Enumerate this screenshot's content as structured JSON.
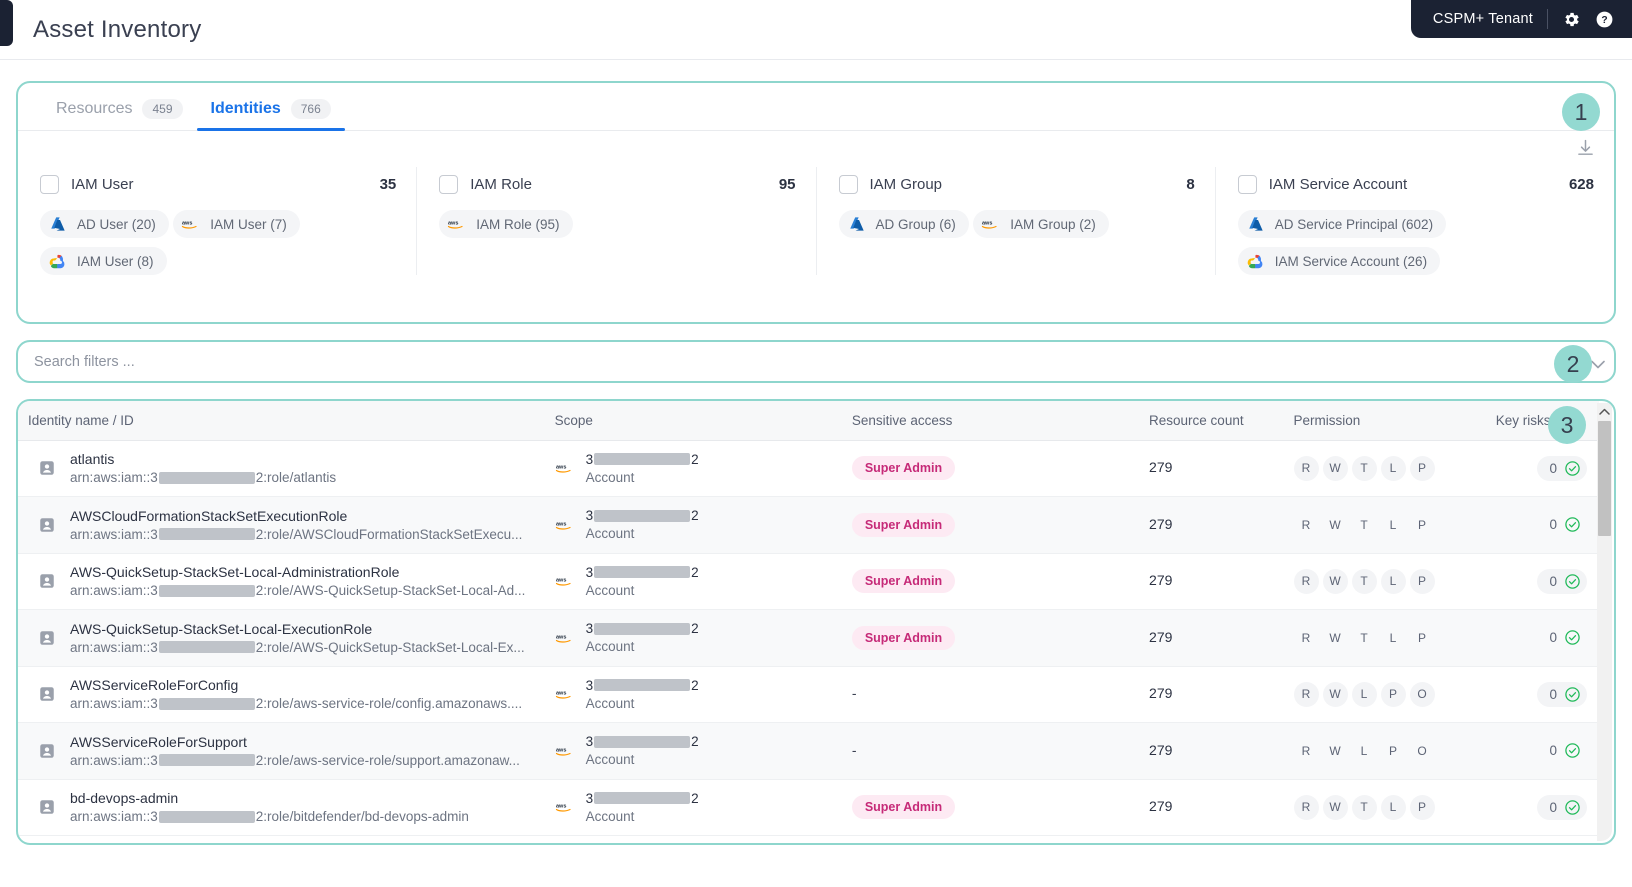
{
  "header": {
    "title": "Asset Inventory",
    "tenant": "CSPM+ Tenant",
    "settings_icon": "gear-icon",
    "help_icon": "help-icon"
  },
  "steps": {
    "one": "1",
    "two": "2",
    "three": "3"
  },
  "tabs": [
    {
      "label": "Resources",
      "count": "459",
      "active": false
    },
    {
      "label": "Identities",
      "count": "766",
      "active": true
    }
  ],
  "toolbar": {
    "download_icon": "download-icon"
  },
  "type_cards": [
    {
      "title": "IAM User",
      "count": "35",
      "pills": [
        {
          "provider": "azure",
          "label": "AD User (20)"
        },
        {
          "provider": "aws",
          "label": "IAM User (7)"
        },
        {
          "provider": "gcp",
          "label": "IAM User (8)"
        }
      ]
    },
    {
      "title": "IAM Role",
      "count": "95",
      "pills": [
        {
          "provider": "aws",
          "label": "IAM Role (95)"
        }
      ]
    },
    {
      "title": "IAM Group",
      "count": "8",
      "pills": [
        {
          "provider": "azure",
          "label": "AD Group (6)"
        },
        {
          "provider": "aws",
          "label": "IAM Group (2)"
        }
      ]
    },
    {
      "title": "IAM Service Account",
      "count": "628",
      "pills": [
        {
          "provider": "azure",
          "label": "AD Service Principal (602)"
        },
        {
          "provider": "gcp",
          "label": "IAM Service Account (26)"
        }
      ]
    }
  ],
  "search": {
    "placeholder": "Search filters ...",
    "value": ""
  },
  "table": {
    "columns": [
      "Identity name / ID",
      "Scope",
      "Sensitive access",
      "Resource count",
      "Permission",
      "Key risks"
    ],
    "scope_prefix": "3",
    "scope_suffix": "2",
    "scope_sub": "Account",
    "arn_prefix": "arn:aws:iam::3",
    "arn_mid": "2:role/",
    "rows": [
      {
        "name": "atlantis",
        "arn_tail": "atlantis",
        "provider": "aws",
        "sensitive": "Super Admin",
        "resource_count": "279",
        "permissions": [
          "R",
          "W",
          "T",
          "L",
          "P"
        ],
        "key_risks": "0",
        "risk_status": "ok"
      },
      {
        "name": "AWSCloudFormationStackSetExecutionRole",
        "arn_tail": "AWSCloudFormationStackSetExecu...",
        "provider": "aws",
        "sensitive": "Super Admin",
        "resource_count": "279",
        "permissions": [
          "R",
          "W",
          "T",
          "L",
          "P"
        ],
        "key_risks": "0",
        "risk_status": "ok"
      },
      {
        "name": "AWS-QuickSetup-StackSet-Local-AdministrationRole",
        "arn_tail": "AWS-QuickSetup-StackSet-Local-Ad...",
        "provider": "aws",
        "sensitive": "Super Admin",
        "resource_count": "279",
        "permissions": [
          "R",
          "W",
          "T",
          "L",
          "P"
        ],
        "key_risks": "0",
        "risk_status": "ok"
      },
      {
        "name": "AWS-QuickSetup-StackSet-Local-ExecutionRole",
        "arn_tail": "AWS-QuickSetup-StackSet-Local-Ex...",
        "provider": "aws",
        "sensitive": "Super Admin",
        "resource_count": "279",
        "permissions": [
          "R",
          "W",
          "T",
          "L",
          "P"
        ],
        "key_risks": "0",
        "risk_status": "ok"
      },
      {
        "name": "AWSServiceRoleForConfig",
        "arn_tail": "aws-service-role/config.amazonaws....",
        "provider": "aws",
        "sensitive": "-",
        "resource_count": "279",
        "permissions": [
          "R",
          "W",
          "L",
          "P",
          "O"
        ],
        "key_risks": "0",
        "risk_status": "ok"
      },
      {
        "name": "AWSServiceRoleForSupport",
        "arn_tail": "aws-service-role/support.amazonaw...",
        "provider": "aws",
        "sensitive": "-",
        "resource_count": "279",
        "permissions": [
          "R",
          "W",
          "L",
          "P",
          "O"
        ],
        "key_risks": "0",
        "risk_status": "ok"
      },
      {
        "name": "bd-devops-admin",
        "arn_tail": "bitdefender/bd-devops-admin",
        "provider": "aws",
        "sensitive": "Super Admin",
        "resource_count": "279",
        "permissions": [
          "R",
          "W",
          "T",
          "L",
          "P"
        ],
        "key_risks": "0",
        "risk_status": "ok"
      }
    ]
  },
  "colors": {
    "accent_highlight": "#8ed6cd",
    "step_badge": "#93d9d1",
    "tab_active": "#1a73e8",
    "super_admin_bg": "#fdeaf3",
    "super_admin_fg": "#c62a78",
    "risk_ok": "#21ba5a",
    "topbar_dark": "#1b2233"
  }
}
